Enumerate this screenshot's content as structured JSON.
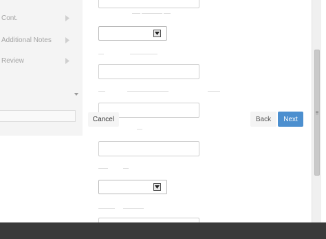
{
  "sidebar": {
    "items": [
      {
        "label": "Cont.",
        "icon": "chevron-right-icon"
      },
      {
        "label": "Additional Notes",
        "icon": "chevron-right-icon"
      },
      {
        "label": "Review",
        "icon": "chevron-right-icon"
      }
    ],
    "scroll_icon": "caret-down-icon"
  },
  "form": {
    "select_icon": "dropdown-arrow-icon"
  },
  "footer": {
    "cancel_label": "Cancel",
    "back_label": "Back",
    "next_label": "Next"
  },
  "colors": {
    "next_button": "#4c8fcf",
    "sidebar_text": "#a5a5a5",
    "overlay": "#3a3a3a"
  }
}
